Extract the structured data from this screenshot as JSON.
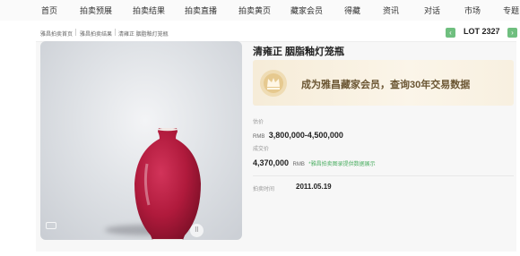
{
  "topnav": {
    "items": [
      {
        "label": "首页"
      },
      {
        "label": "拍卖预展"
      },
      {
        "label": "拍卖结果"
      },
      {
        "label": "拍卖直播"
      },
      {
        "label": "拍卖黄页"
      },
      {
        "label": "藏家会员"
      },
      {
        "label": "得藏"
      },
      {
        "label": "资讯"
      },
      {
        "label": "对话"
      },
      {
        "label": "市场"
      },
      {
        "label": "专题"
      }
    ]
  },
  "breadcrumb": {
    "items": [
      "雅昌拍卖首页",
      "雅昌拍卖结果",
      "清雍正 胭脂釉灯笼瓶"
    ]
  },
  "lot": {
    "label": "LOT 2327",
    "prev_icon": "chevron-left-icon",
    "next_icon": "chevron-right-icon",
    "dropdown_icon": "chevron-down-icon"
  },
  "item": {
    "title": "清雍正 胭脂釉灯笼瓶",
    "image_alt": "rouge-red lantern vase",
    "vase_color": "#b01a3c"
  },
  "banner": {
    "text": "成为雅昌藏家会员，查询30年交易数据",
    "crown_icon": "crown-icon"
  },
  "estimate": {
    "label": "估价",
    "currency": "RMB",
    "value": "3,800,000-4,500,000"
  },
  "deal": {
    "label": "成交价",
    "value": "4,370,000",
    "currency": "RMB",
    "note": "*雅昌拍卖图录提供数据展示"
  },
  "auction_time": {
    "label": "拍卖时间",
    "value": "2011.05.19"
  },
  "colors": {
    "accent_green": "#6fbf7f",
    "banner_text": "#6b5633"
  }
}
